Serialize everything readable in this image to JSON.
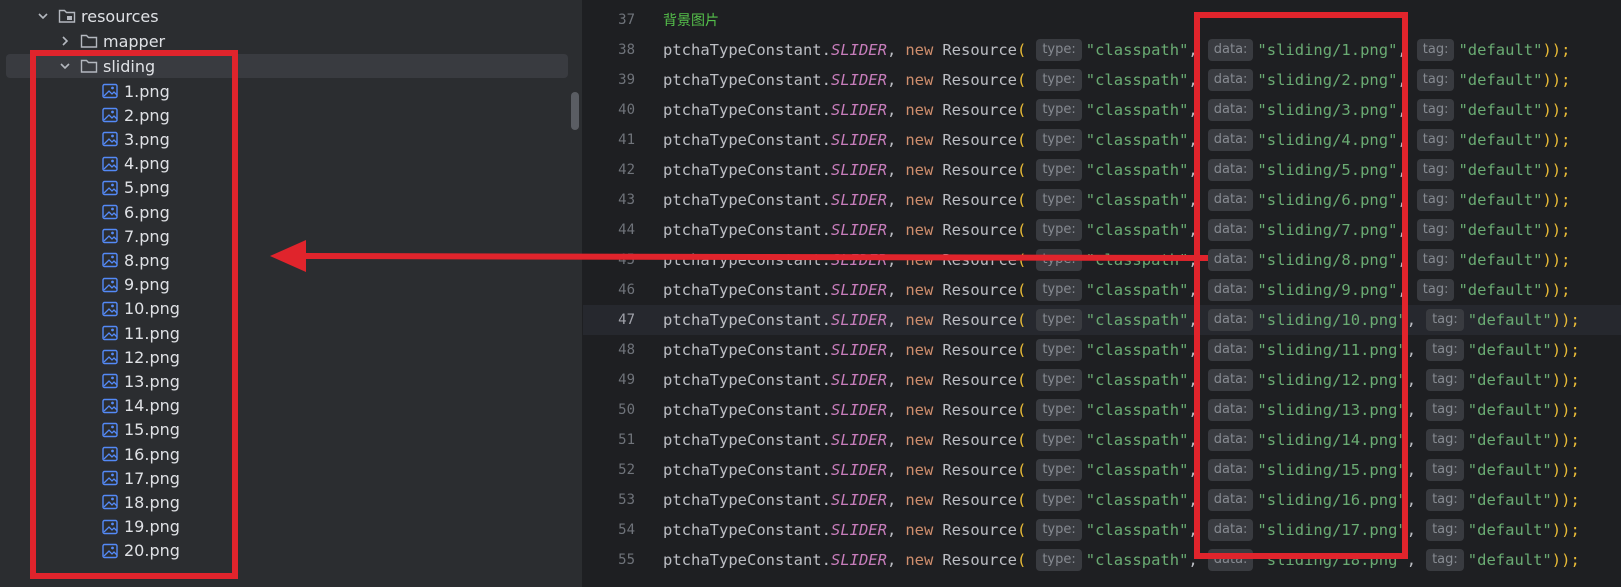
{
  "tree": {
    "items": [
      {
        "label": "resources",
        "kind": "folder",
        "expanded": true
      },
      {
        "label": "mapper",
        "kind": "folder",
        "expanded": false
      },
      {
        "label": "sliding",
        "kind": "folder",
        "expanded": true,
        "selected": true
      },
      {
        "label": "1.png",
        "kind": "image"
      },
      {
        "label": "2.png",
        "kind": "image"
      },
      {
        "label": "3.png",
        "kind": "image"
      },
      {
        "label": "4.png",
        "kind": "image"
      },
      {
        "label": "5.png",
        "kind": "image"
      },
      {
        "label": "6.png",
        "kind": "image"
      },
      {
        "label": "7.png",
        "kind": "image"
      },
      {
        "label": "8.png",
        "kind": "image"
      },
      {
        "label": "9.png",
        "kind": "image"
      },
      {
        "label": "10.png",
        "kind": "image"
      },
      {
        "label": "11.png",
        "kind": "image"
      },
      {
        "label": "12.png",
        "kind": "image"
      },
      {
        "label": "13.png",
        "kind": "image"
      },
      {
        "label": "14.png",
        "kind": "image"
      },
      {
        "label": "15.png",
        "kind": "image"
      },
      {
        "label": "16.png",
        "kind": "image"
      },
      {
        "label": "17.png",
        "kind": "image"
      },
      {
        "label": "18.png",
        "kind": "image"
      },
      {
        "label": "19.png",
        "kind": "image"
      },
      {
        "label": "20.png",
        "kind": "image"
      }
    ]
  },
  "editor": {
    "comment_line": {
      "number": "37",
      "text": "背景图片"
    },
    "current_line": "47",
    "code_parts": {
      "prefix": "ptchaTypeConstant.",
      "constant": "SLIDER",
      "comma": ",",
      "kw_new": "new",
      "class_name": "Resource",
      "open_paren": "(",
      "hint_type": "type:",
      "type_value": "\"classpath\"",
      "hint_data": "data:",
      "hint_tag": "tag:",
      "tag_value": "\"default\"",
      "close": "));"
    },
    "lines": [
      {
        "number": "38",
        "data_value": "\"sliding/1.png\""
      },
      {
        "number": "39",
        "data_value": "\"sliding/2.png\""
      },
      {
        "number": "40",
        "data_value": "\"sliding/3.png\""
      },
      {
        "number": "41",
        "data_value": "\"sliding/4.png\""
      },
      {
        "number": "42",
        "data_value": "\"sliding/5.png\""
      },
      {
        "number": "43",
        "data_value": "\"sliding/6.png\""
      },
      {
        "number": "44",
        "data_value": "\"sliding/7.png\""
      },
      {
        "number": "45",
        "data_value": "\"sliding/8.png\""
      },
      {
        "number": "46",
        "data_value": "\"sliding/9.png\""
      },
      {
        "number": "47",
        "data_value": "\"sliding/10.png\""
      },
      {
        "number": "48",
        "data_value": "\"sliding/11.png\""
      },
      {
        "number": "49",
        "data_value": "\"sliding/12.png\""
      },
      {
        "number": "50",
        "data_value": "\"sliding/13.png\""
      },
      {
        "number": "51",
        "data_value": "\"sliding/14.png\""
      },
      {
        "number": "52",
        "data_value": "\"sliding/15.png\""
      },
      {
        "number": "53",
        "data_value": "\"sliding/16.png\""
      },
      {
        "number": "54",
        "data_value": "\"sliding/17.png\""
      },
      {
        "number": "55",
        "data_value": "\"sliding/18.png\""
      }
    ]
  },
  "annotation": {
    "color": "#e0242c"
  },
  "colors": {
    "keyword": "#cf8e6d",
    "string": "#6aab73",
    "constant": "#c77dbb",
    "comment": "#55c04b"
  }
}
